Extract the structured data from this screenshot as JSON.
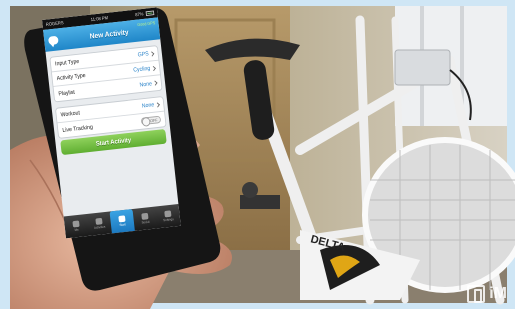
{
  "status_bar": {
    "carrier": "ROGERS",
    "time": "11:08 PM",
    "battery": "87%"
  },
  "header": {
    "title": "New Activity",
    "gps_badge": "Good GPS"
  },
  "form": {
    "rows": [
      {
        "label": "Input Type",
        "value": "GPS"
      },
      {
        "label": "Activity Type",
        "value": "Cycling"
      },
      {
        "label": "Playlist",
        "value": "None"
      }
    ],
    "workout": {
      "label": "Workout",
      "value": "None"
    },
    "live_tracking": {
      "label": "Live Tracking",
      "toggle": "OFF"
    },
    "start_button": "Start Activity"
  },
  "tabbar": [
    "Me",
    "Activities",
    "Start",
    "Social",
    "Settings"
  ],
  "bike_label": "DELTA",
  "watermark": "iM",
  "colors": {
    "accent": "#1f86c8",
    "start": "#6fbf3f"
  }
}
